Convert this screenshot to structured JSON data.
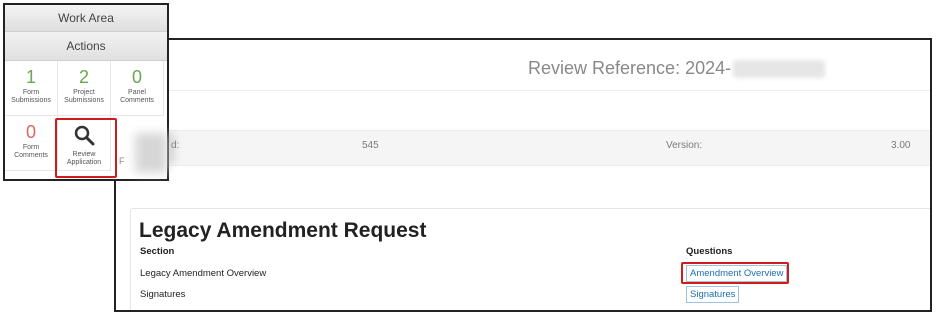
{
  "work_area": {
    "title": "Work Area",
    "actions_label": "Actions",
    "tiles": [
      {
        "count": "1",
        "label": "Form\nSubmissions",
        "color": "#6aa84f"
      },
      {
        "count": "2",
        "label": "Project\nSubmissions",
        "color": "#6aa84f"
      },
      {
        "count": "0",
        "label": "Panel\nComments",
        "color": "#6aa84f"
      },
      {
        "count": "0",
        "label": "Form\nComments",
        "color": "#e06666"
      },
      {
        "icon": "search-icon",
        "label": "Review\nApplication"
      }
    ],
    "side_text": "F"
  },
  "main": {
    "review_reference_label": "Review Reference: 2024-",
    "info": {
      "field_label_fragment": "d:",
      "field_value": "545",
      "version_label": "Version:",
      "version_value": "3.00"
    },
    "card": {
      "title": "Legacy Amendment Request",
      "section_header": "Section",
      "questions_header": "Questions",
      "rows": [
        {
          "section": "Legacy Amendment Overview",
          "question": "Amendment Overview"
        },
        {
          "section": "Signatures",
          "question": "Signatures"
        }
      ]
    }
  },
  "colors": {
    "highlight": "#d11a1a",
    "link": "#1a6fb0",
    "count_green": "#6aa84f",
    "count_red": "#e06666"
  }
}
